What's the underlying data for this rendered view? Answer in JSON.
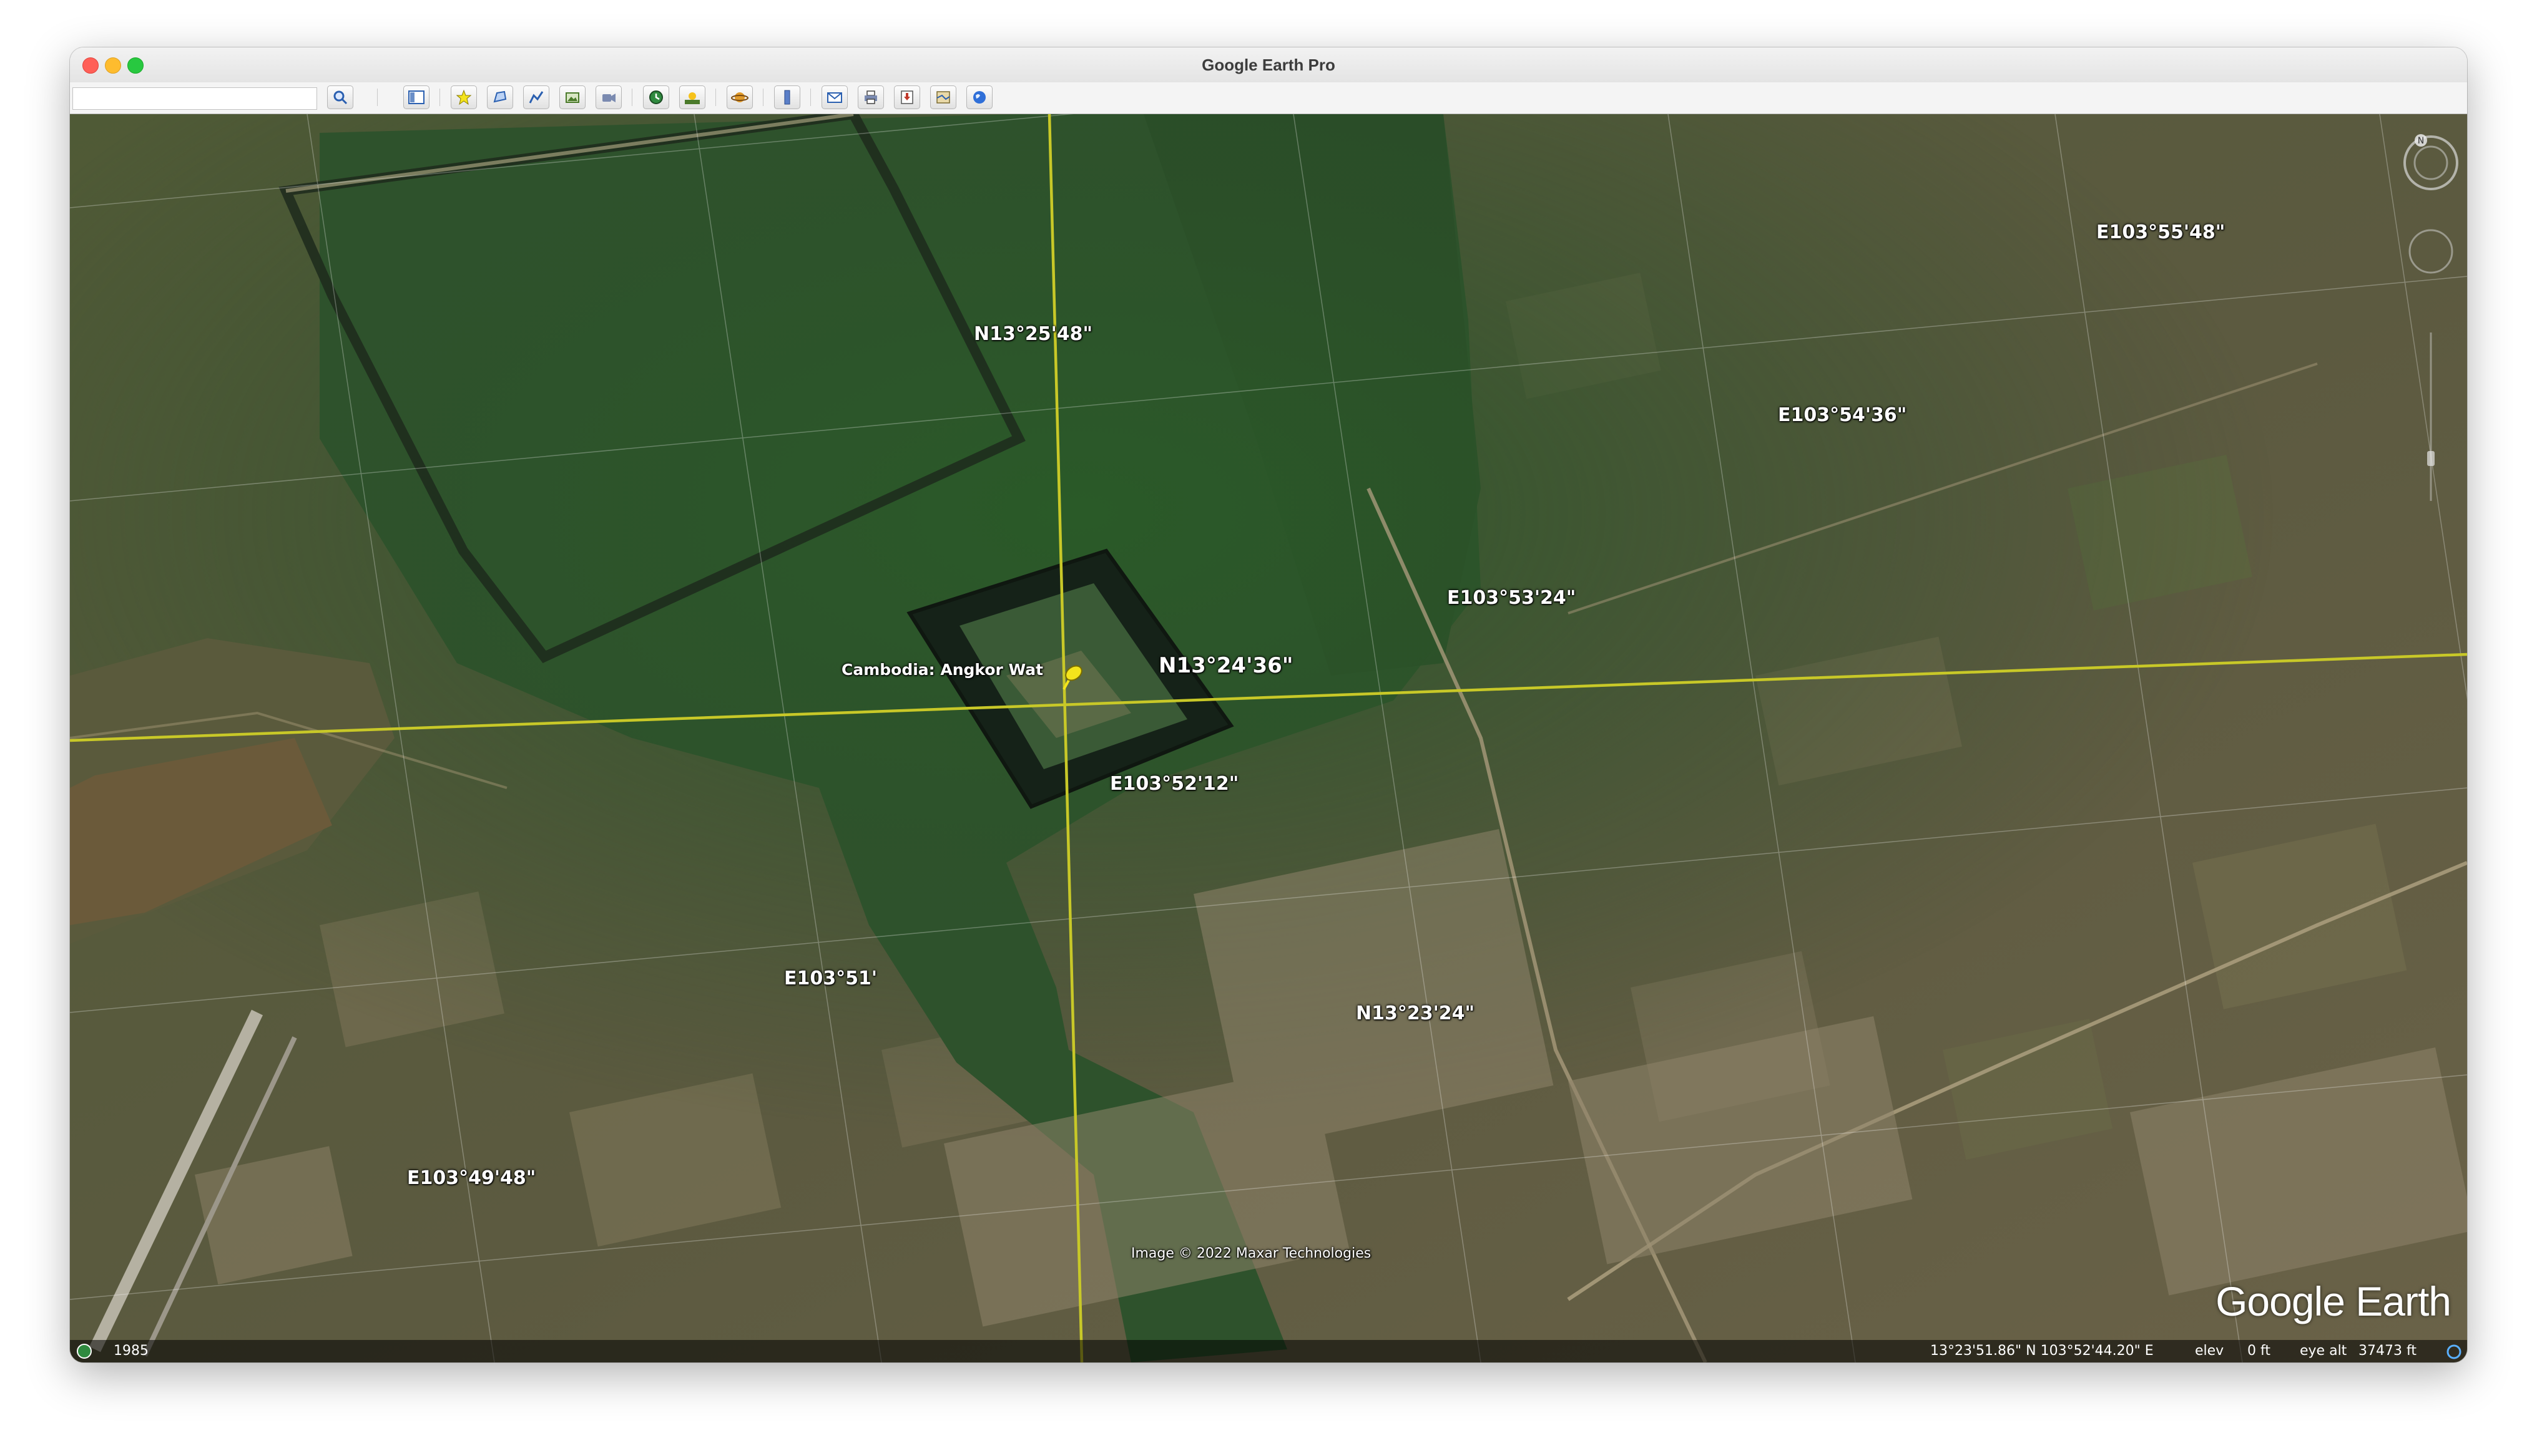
{
  "window": {
    "title": "Google Earth Pro"
  },
  "toolbar": {
    "search_placeholder": "",
    "buttons": [
      {
        "name": "search-icon"
      },
      {
        "name": "sidebar-toggle-icon"
      },
      {
        "name": "add-placemark-icon"
      },
      {
        "name": "add-polygon-icon"
      },
      {
        "name": "add-path-icon"
      },
      {
        "name": "add-image-overlay-icon"
      },
      {
        "name": "record-tour-icon"
      },
      {
        "name": "historical-imagery-icon"
      },
      {
        "name": "sunlight-icon"
      },
      {
        "name": "planets-icon"
      },
      {
        "name": "ruler-icon"
      },
      {
        "name": "email-icon"
      },
      {
        "name": "print-icon"
      },
      {
        "name": "save-image-icon"
      },
      {
        "name": "view-in-maps-icon"
      },
      {
        "name": "earth-globe-icon"
      }
    ]
  },
  "map": {
    "grid_labels": [
      {
        "id": "lat-1",
        "text": "N13°25'48\""
      },
      {
        "id": "lat-2",
        "text": "N13°24'36\""
      },
      {
        "id": "lat-3",
        "text": "N13°23'24\""
      },
      {
        "id": "lon-1",
        "text": "E103°55'48\""
      },
      {
        "id": "lon-2",
        "text": "E103°54'36\""
      },
      {
        "id": "lon-3",
        "text": "E103°53'24\""
      },
      {
        "id": "lon-4",
        "text": "E103°52'12\""
      },
      {
        "id": "lon-5",
        "text": "E103°51'"
      },
      {
        "id": "lon-6",
        "text": "E103°49'48\""
      }
    ],
    "placemark": {
      "label": "Cambodia: Angkor Wat",
      "color": "#f4e41c"
    },
    "attribution": "Image © 2022 Maxar Technologies",
    "logo_text": "Google Earth",
    "grid_line_color": "#c8c828"
  },
  "status": {
    "year": "1985",
    "coordinates": "13°23'51.86\" N  103°52'44.20\" E",
    "elev_label": "elev",
    "elev_value": "0 ft",
    "eye_alt_label": "eye alt",
    "eye_alt_value": "37473 ft"
  }
}
